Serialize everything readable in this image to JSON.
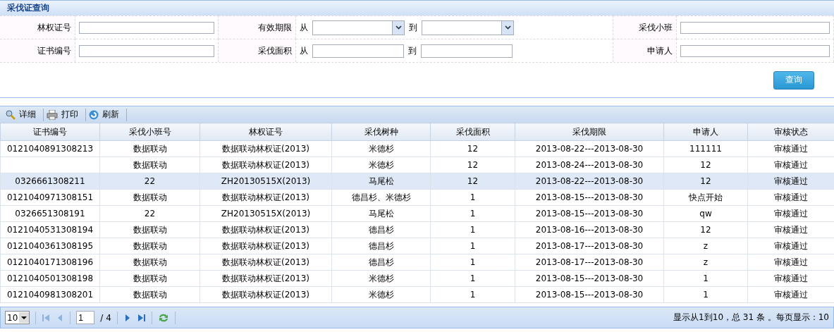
{
  "panel": {
    "title": "采伐证查询"
  },
  "form": {
    "rows": [
      {
        "field1": {
          "label": "林权证号"
        },
        "field2": {
          "label": "有效期限",
          "from": "从",
          "to": "到",
          "kind": "select"
        },
        "field3": {
          "label": "采伐小班"
        }
      },
      {
        "field1": {
          "label": "证书编号"
        },
        "field2": {
          "label": "采伐面积",
          "from": "从",
          "to": "到",
          "kind": "text"
        },
        "field3": {
          "label": "申请人"
        }
      }
    ],
    "search_button": "查询"
  },
  "toolbar": [
    "详细",
    "打印",
    "刷新"
  ],
  "table": {
    "columns": [
      "证书编号",
      "采伐小班号",
      "林权证号",
      "采伐树种",
      "采伐面积",
      "采伐期限",
      "申请人",
      "审核状态"
    ],
    "rows": [
      {
        "selected": false,
        "cells": [
          "0121040891308213",
          "数据联动",
          "数据联动林权证(2013)",
          "米德杉",
          "12",
          "2013-08-22---2013-08-30",
          "111111",
          "审核通过"
        ]
      },
      {
        "selected": false,
        "cells": [
          "",
          "数据联动",
          "数据联动林权证(2013)",
          "米德杉",
          "12",
          "2013-08-24---2013-08-30",
          "12",
          "审核通过"
        ]
      },
      {
        "selected": true,
        "cells": [
          "0326661308211",
          "22",
          "ZH20130515X(2013)",
          "马尾松",
          "12",
          "2013-08-22---2013-08-30",
          "12",
          "审核通过"
        ]
      },
      {
        "selected": false,
        "cells": [
          "0121040971308151",
          "数据联动",
          "数据联动林权证(2013)",
          "德昌杉、米德杉",
          "1",
          "2013-08-15---2013-08-30",
          "快点开始",
          "审核通过"
        ]
      },
      {
        "selected": false,
        "cells": [
          "0326651308191",
          "22",
          "ZH20130515X(2013)",
          "马尾松",
          "1",
          "2013-08-15---2013-08-30",
          "qw",
          "审核通过"
        ]
      },
      {
        "selected": false,
        "cells": [
          "0121040531308194",
          "数据联动",
          "数据联动林权证(2013)",
          "德昌杉",
          "1",
          "2013-08-16---2013-08-30",
          "12",
          "审核通过"
        ]
      },
      {
        "selected": false,
        "cells": [
          "0121040361308195",
          "数据联动",
          "数据联动林权证(2013)",
          "德昌杉",
          "1",
          "2013-08-17---2013-08-30",
          "z",
          "审核通过"
        ]
      },
      {
        "selected": false,
        "cells": [
          "0121040171308196",
          "数据联动",
          "数据联动林权证(2013)",
          "德昌杉",
          "1",
          "2013-08-17---2013-08-30",
          "z",
          "审核通过"
        ]
      },
      {
        "selected": false,
        "cells": [
          "0121040501308198",
          "数据联动",
          "数据联动林权证(2013)",
          "米德杉",
          "1",
          "2013-08-15---2013-08-30",
          "1",
          "审核通过"
        ]
      },
      {
        "selected": false,
        "cells": [
          "0121040981308201",
          "数据联动",
          "数据联动林权证(2013)",
          "米德杉",
          "1",
          "2013-08-15---2013-08-30",
          "1",
          "审核通过"
        ]
      }
    ]
  },
  "pager": {
    "page_size": "10",
    "page": "1",
    "total_pages": "/ 4",
    "summary": "显示从1到10，总 31 条 。每页显示：10"
  }
}
